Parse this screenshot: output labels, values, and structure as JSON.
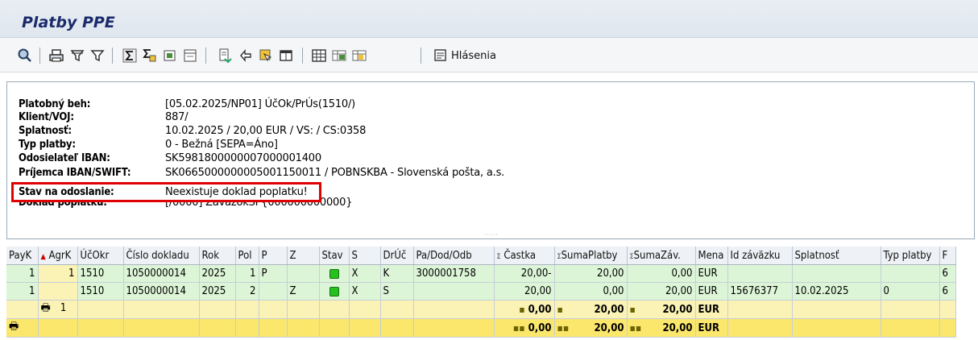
{
  "window": {
    "title": "Platby PPE"
  },
  "toolbar": {
    "messages_label": "Hlásenia",
    "icons": [
      "details-icon",
      "print-icon",
      "filter-icon",
      "filter-set-icon",
      "sum-icon",
      "subtotal-icon",
      "export-icon",
      "layout-icon",
      "export-spreadsheet-icon",
      "sort-icon",
      "find-icon",
      "view-icon",
      "grid-icon",
      "layout-change-icon",
      "layout-select-icon",
      "messages-icon"
    ]
  },
  "header_fields": {
    "payment_run_label": "Platobný beh:",
    "payment_run_value": "[05.02.2025/NP01] ÚčOk/PrÚs(1510/)",
    "client_label": "Klient/VOJ:",
    "client_value": "887/",
    "due_label": "Splatnosť:",
    "due_value": "10.02.2025 / 20,00 EUR / VS: / CS:0358",
    "payment_type_label": "Typ platby:",
    "payment_type_value": "0 - Bežná [SEPA=Áno]",
    "sender_iban_label": "Odosielateľ IBAN:",
    "sender_iban_value": "SK5981800000007000001400",
    "recipient_label": "Príjemca IBAN/SWIFT:",
    "recipient_value": "SK0665000000005001150011 / POBNSKBA - Slovenská pošta, a.s.",
    "send_status_label": "Stav na odoslanie:",
    "send_status_value": "Neexistuje doklad poplatku!",
    "fee_doc_label": "Doklad poplatku:",
    "fee_doc_value": "[/0000] ZávazokSP{000000000000}"
  },
  "grid": {
    "columns": [
      "PayK",
      "AgrK",
      "ÚčOkr",
      "Číslo dokladu",
      "Rok",
      "Pol",
      "P",
      "Z",
      "Stav",
      "S",
      "DrÚč",
      "Pa/Dod/Odb",
      "Častka",
      "SumaPlatby",
      "SumaZáv.",
      "Mena",
      "Id záväzku",
      "Splatnosť",
      "Typ platby",
      "F"
    ],
    "rows": [
      {
        "payk": "1",
        "agrk": "1",
        "ucokr": "1510",
        "doc": "1050000014",
        "rok": "2025",
        "pol": "1",
        "p": "P",
        "z": "",
        "stav": "green",
        "s": "X",
        "druc": "K",
        "pa": "3000001758",
        "castka": "20,00-",
        "suma_platby": "20,00",
        "suma_zav": "0,00",
        "mena": "EUR",
        "id_zav": "",
        "splatnost": "",
        "typ": "",
        "f": "6"
      },
      {
        "payk": "1",
        "agrk": "",
        "ucokr": "1510",
        "doc": "1050000014",
        "rok": "2025",
        "pol": "2",
        "p": "",
        "z": "Z",
        "stav": "green",
        "s": "X",
        "druc": "S",
        "pa": "",
        "castka": "20,00",
        "suma_platby": "0,00",
        "suma_zav": "20,00",
        "mena": "EUR",
        "id_zav": "15676377",
        "splatnost": "10.02.2025",
        "typ": "0",
        "f": "6"
      }
    ],
    "subtotal": {
      "agrk": "1",
      "castka": "0,00",
      "suma_platby": "20,00",
      "suma_zav": "20,00",
      "mena": "EUR"
    },
    "total": {
      "castka": "0,00",
      "suma_platby": "20,00",
      "suma_zav": "20,00",
      "mena": "EUR"
    }
  }
}
